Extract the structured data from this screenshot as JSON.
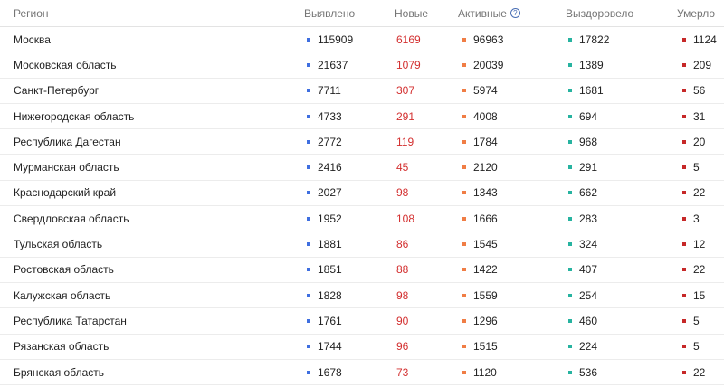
{
  "colors": {
    "detected": "#3f6fe0",
    "new": "#d32f2f",
    "active": "#f07d45",
    "recovered": "#27b3a0",
    "deaths": "#c62828"
  },
  "header": {
    "region": "Регион",
    "detected": "Выявлено",
    "new": "Новые",
    "active": "Активные",
    "active_help": "?",
    "recovered": "Выздоровело",
    "deaths": "Умерло"
  },
  "rows": [
    {
      "region": "Москва",
      "detected": "115909",
      "new": "6169",
      "active": "96963",
      "recovered": "17822",
      "deaths": "1124"
    },
    {
      "region": "Московская область",
      "detected": "21637",
      "new": "1079",
      "active": "20039",
      "recovered": "1389",
      "deaths": "209"
    },
    {
      "region": "Санкт-Петербург",
      "detected": "7711",
      "new": "307",
      "active": "5974",
      "recovered": "1681",
      "deaths": "56"
    },
    {
      "region": "Нижегородская область",
      "detected": "4733",
      "new": "291",
      "active": "4008",
      "recovered": "694",
      "deaths": "31"
    },
    {
      "region": "Республика Дагестан",
      "detected": "2772",
      "new": "119",
      "active": "1784",
      "recovered": "968",
      "deaths": "20"
    },
    {
      "region": "Мурманская область",
      "detected": "2416",
      "new": "45",
      "active": "2120",
      "recovered": "291",
      "deaths": "5"
    },
    {
      "region": "Краснодарский край",
      "detected": "2027",
      "new": "98",
      "active": "1343",
      "recovered": "662",
      "deaths": "22"
    },
    {
      "region": "Свердловская область",
      "detected": "1952",
      "new": "108",
      "active": "1666",
      "recovered": "283",
      "deaths": "3"
    },
    {
      "region": "Тульская область",
      "detected": "1881",
      "new": "86",
      "active": "1545",
      "recovered": "324",
      "deaths": "12"
    },
    {
      "region": "Ростовская область",
      "detected": "1851",
      "new": "88",
      "active": "1422",
      "recovered": "407",
      "deaths": "22"
    },
    {
      "region": "Калужская область",
      "detected": "1828",
      "new": "98",
      "active": "1559",
      "recovered": "254",
      "deaths": "15"
    },
    {
      "region": "Республика Татарстан",
      "detected": "1761",
      "new": "90",
      "active": "1296",
      "recovered": "460",
      "deaths": "5"
    },
    {
      "region": "Рязанская область",
      "detected": "1744",
      "new": "96",
      "active": "1515",
      "recovered": "224",
      "deaths": "5"
    },
    {
      "region": "Брянская область",
      "detected": "1678",
      "new": "73",
      "active": "1120",
      "recovered": "536",
      "deaths": "22"
    }
  ]
}
